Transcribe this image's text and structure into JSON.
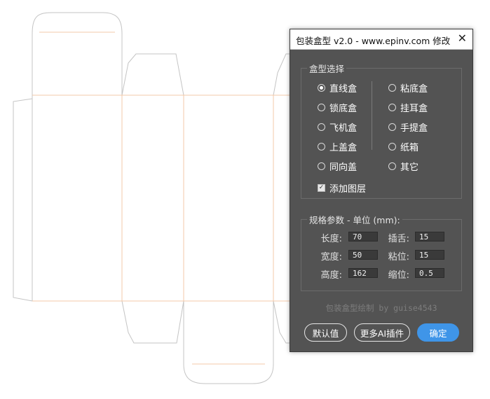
{
  "dialog": {
    "title": "包装盒型 v2.0 - www.epinv.com 修改",
    "close_icon": "close-icon"
  },
  "box_type": {
    "legend": "盒型选择",
    "left_options": [
      {
        "label": "直线盒",
        "selected": true
      },
      {
        "label": "锁底盒",
        "selected": false
      },
      {
        "label": "飞机盒",
        "selected": false
      },
      {
        "label": "上盖盒",
        "selected": false
      },
      {
        "label": "同向盖",
        "selected": false
      }
    ],
    "right_options": [
      {
        "label": "粘底盒",
        "selected": false
      },
      {
        "label": "挂耳盒",
        "selected": false
      },
      {
        "label": "手提盒",
        "selected": false
      },
      {
        "label": "纸箱",
        "selected": false
      },
      {
        "label": "其它",
        "selected": false
      }
    ],
    "add_layer": {
      "label": "添加图层",
      "checked": true
    }
  },
  "params": {
    "legend": "规格参数 - 单位 (mm):",
    "length_label": "长度:",
    "length_value": "70",
    "width_label": "宽度:",
    "width_value": "50",
    "height_label": "高度:",
    "height_value": "162",
    "tuck_label": "插舌:",
    "tuck_value": "15",
    "glue_label": "粘位:",
    "glue_value": "15",
    "shrink_label": "缩位:",
    "shrink_value": "0.5"
  },
  "footer": {
    "text": "包装盒型绘制 by guise4543"
  },
  "buttons": {
    "default": "默认值",
    "more": "更多AI插件",
    "ok": "确定"
  },
  "colors": {
    "panel": "#535353",
    "primary": "#3f95e8",
    "cut_line": "#c4c4c4",
    "fold_line": "#f3c9a8"
  }
}
